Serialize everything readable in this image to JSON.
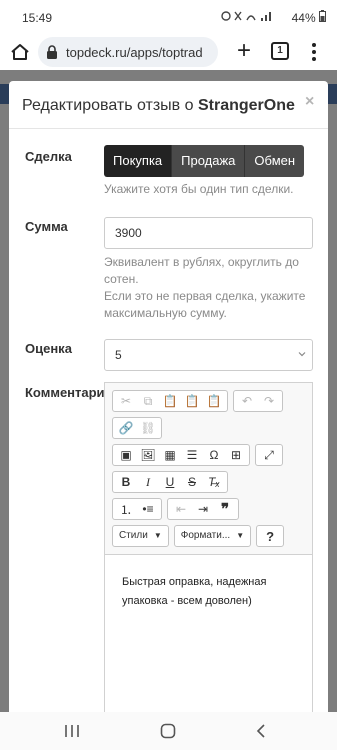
{
  "status": {
    "time": "15:49",
    "icons_text": "⏰ ✕ 📶 ᵢₗ",
    "battery": "44%"
  },
  "browser": {
    "url": "topdeck.ru/apps/toptrad",
    "tab_count": "1"
  },
  "modal": {
    "title_prefix": "Редактировать отзыв о ",
    "title_user": "StrangerOne",
    "close": "×"
  },
  "form": {
    "deal_label": "Сделка",
    "deal_options": [
      "Покупка",
      "Продажа",
      "Обмен"
    ],
    "deal_help": "Укажите хотя бы один тип сделки.",
    "sum_label": "Сумма",
    "sum_value": "3900",
    "sum_help_1": "Эквивалент в рублях, округлить до сотен.",
    "sum_help_2": "Если это не первая сделка, укажите максимальную сумму.",
    "rating_label": "Оценка",
    "rating_value": "5",
    "comment_label": "Комментарий"
  },
  "editor": {
    "styles_combo": "Стили",
    "format_combo": "Формати...",
    "help_button": "?",
    "content": "Быстрая оправка, надежная упаковка - всем доволен)"
  }
}
